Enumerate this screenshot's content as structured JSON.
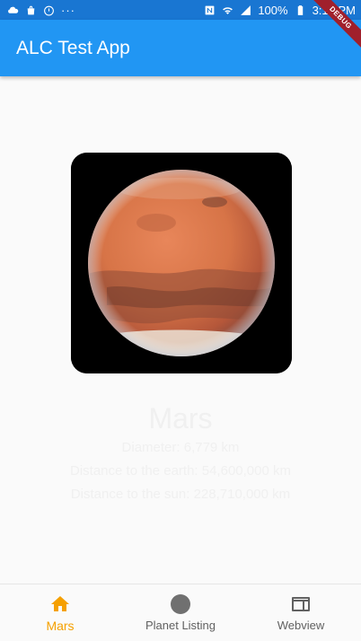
{
  "status_bar": {
    "left_icons": [
      "cloud-icon",
      "bag-icon",
      "speedometer-icon"
    ],
    "dots": "···",
    "battery_percent": "100%",
    "time": "3:15 PM"
  },
  "app_bar": {
    "title": "ALC Test App",
    "debug_label": "DEBUG",
    "color": "#2196f3"
  },
  "planet": {
    "name": "Mars",
    "diameter": "Diameter: 6,779 km",
    "distance_earth": "Distance to the earth: 54,600,000 km",
    "distance_sun": "Distance to the sun: 228,710,000 km"
  },
  "bottom_nav": {
    "active_color": "#f5a000",
    "items": [
      {
        "label": "Mars",
        "icon": "home-icon"
      },
      {
        "label": "Planet Listing",
        "icon": "circle-icon"
      },
      {
        "label": "Webview",
        "icon": "web-icon"
      }
    ]
  }
}
